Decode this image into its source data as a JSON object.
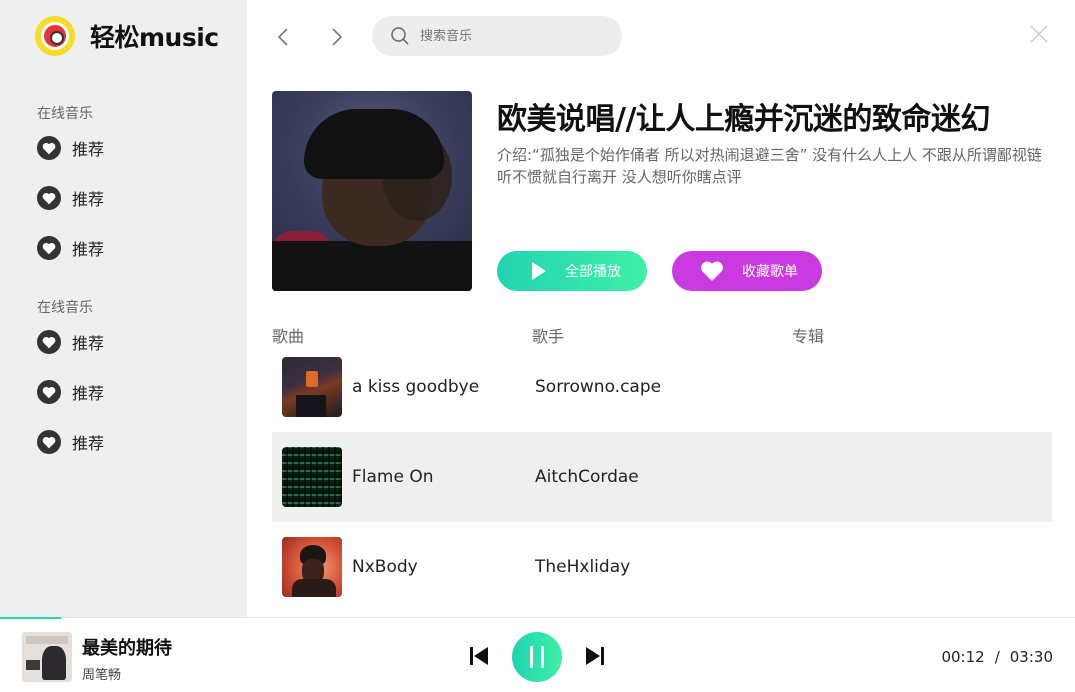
{
  "app": {
    "name": "轻松music",
    "accent": "#25d6b0",
    "fav_color": "#c93ae0"
  },
  "sidebar": {
    "sections": [
      {
        "title": "在线音乐",
        "items": [
          {
            "label": "推荐",
            "icon": "heart-icon"
          },
          {
            "label": "推荐",
            "icon": "heart-icon"
          },
          {
            "label": "推荐",
            "icon": "heart-icon"
          }
        ]
      },
      {
        "title": "在线音乐",
        "items": [
          {
            "label": "推荐",
            "icon": "heart-icon"
          },
          {
            "label": "推荐",
            "icon": "heart-icon"
          },
          {
            "label": "推荐",
            "icon": "heart-icon"
          }
        ]
      }
    ]
  },
  "search": {
    "placeholder": "搜索音乐",
    "value": ""
  },
  "playlist": {
    "title": "欧美说唱//让人上瘾并沉迷的致命迷幻",
    "description": "介绍:“孤独是个始作俑者 所以对热闹退避三舍” 没有什么人上人 不跟从所谓鄙视链 听不惯就自行离开 没人想听你瞎点评",
    "play_all_label": "全部播放",
    "favorite_label": "收藏歌单"
  },
  "table": {
    "headers": {
      "song": "歌曲",
      "artist": "歌手",
      "album": "专辑"
    },
    "rows": [
      {
        "song": "a kiss goodbye",
        "artist": "Sorrowno.cape",
        "album": ""
      },
      {
        "song": "Flame On",
        "artist": "AitchCordae",
        "album": ""
      },
      {
        "song": "NxBody",
        "artist": "TheHxliday",
        "album": ""
      }
    ],
    "active_row": 1
  },
  "player": {
    "title": "最美的期待",
    "artist": "周笔畅",
    "current_time": "00:12",
    "separator": "/",
    "duration": "03:30",
    "progress": 0.057,
    "state": "playing"
  }
}
